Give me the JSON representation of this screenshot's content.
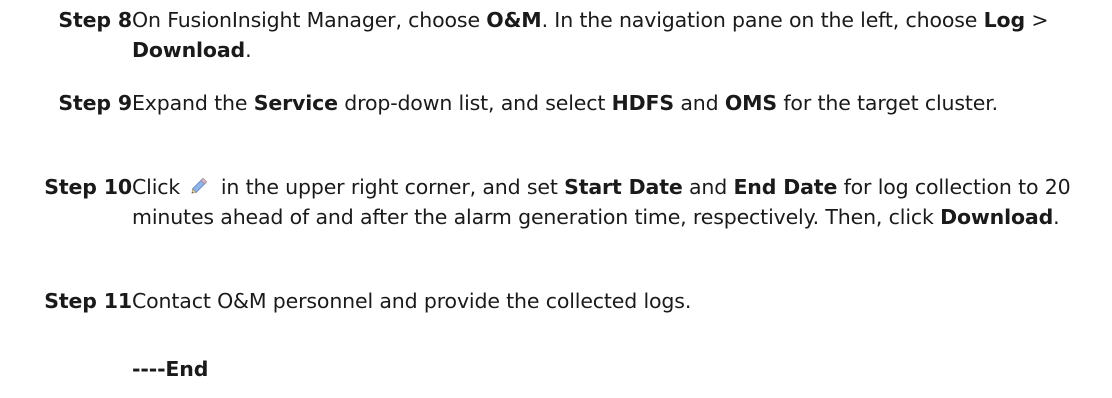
{
  "steps": [
    {
      "label": "Step 8",
      "parts": [
        {
          "t": "On FusionInsight Manager, choose "
        },
        {
          "b": "O&M"
        },
        {
          "t": ". In the navigation pane on the left, choose "
        },
        {
          "b": "Log"
        },
        {
          "t": " > "
        },
        {
          "b": "Download"
        },
        {
          "t": "."
        }
      ]
    },
    {
      "label": "Step 9",
      "parts": [
        {
          "t": "Expand the "
        },
        {
          "b": "Service"
        },
        {
          "t": " drop-down list, and select "
        },
        {
          "b": "HDFS"
        },
        {
          "t": " and "
        },
        {
          "b": "OMS"
        },
        {
          "t": " for the target cluster."
        }
      ]
    },
    {
      "label": "Step 10",
      "parts": [
        {
          "t": "Click "
        },
        {
          "icon": "pencil-icon"
        },
        {
          "t": " in the upper right corner, and set "
        },
        {
          "b": "Start Date"
        },
        {
          "t": " and "
        },
        {
          "b": "End Date"
        },
        {
          "t": " for log collection to 20 minutes ahead of and after the alarm generation time, respectively. Then, click "
        },
        {
          "b": "Download"
        },
        {
          "t": "."
        }
      ]
    },
    {
      "label": "Step 11",
      "parts": [
        {
          "t": "Contact O&M personnel and provide the collected logs."
        }
      ]
    }
  ],
  "end_marker": "----End"
}
